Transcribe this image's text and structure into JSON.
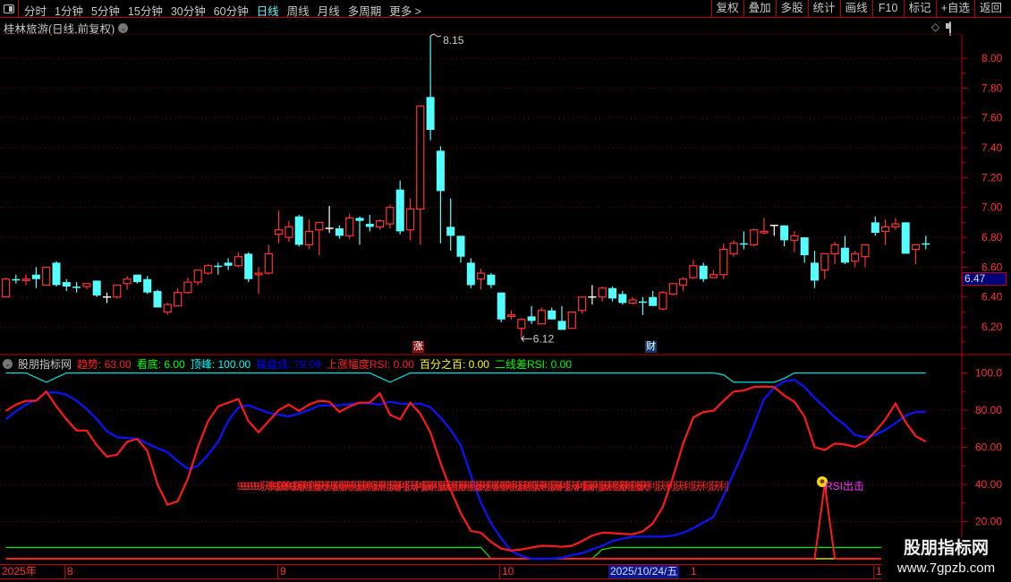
{
  "toolbar": {
    "periods": [
      "分时",
      "1分钟",
      "5分钟",
      "15分钟",
      "30分钟",
      "60分钟",
      "日线",
      "周线",
      "月线",
      "多周期",
      "更多 >"
    ],
    "active_period": "日线",
    "right_buttons": [
      "复权",
      "叠加",
      "多股",
      "统计",
      "画线",
      "F10",
      "标记",
      "+自选",
      "返回"
    ]
  },
  "chart_header": {
    "title": "桂林旅游(日线,前复权)"
  },
  "price_axis": {
    "ticks": [
      "8.00",
      "7.80",
      "7.60",
      "7.40",
      "7.20",
      "7.00",
      "6.80",
      "6.60",
      "6.40",
      "6.20"
    ],
    "current_price": "6.47"
  },
  "annotations": {
    "high_label": "8.15",
    "low_label": "6.12",
    "badge_zhang": "涨",
    "badge_cai": "财"
  },
  "indicator": {
    "name": "股朋指标网",
    "fields": [
      {
        "label": "趋势",
        "value": "63.00",
        "color": "#ff2020"
      },
      {
        "label": "看底",
        "value": "6.00",
        "color": "#00ff00"
      },
      {
        "label": "顶峰",
        "value": "100.00",
        "color": "#00ffff"
      },
      {
        "label": "操盘线",
        "value": "79.09",
        "color": "#0000ff"
      },
      {
        "label": "上涨幅度RSI",
        "value": "0.00",
        "color": "#ff2020"
      },
      {
        "label": "百分之百",
        "value": "0.00",
        "color": "#ffff00"
      },
      {
        "label": "二线差RSI",
        "value": "0.00",
        "color": "#00ff00"
      }
    ],
    "axis_ticks": [
      "100.0",
      "80.00",
      "60.00",
      "40.00",
      "20.00"
    ],
    "overlap_text": "9999999获利获利获利获利获利获利获利获利获利获利获利获利获利获利获利获利获利获利获利获利获利获利获利获利",
    "signal_label": "RSI出击"
  },
  "time_axis": {
    "labels": [
      "2025年",
      "8",
      "9",
      "10",
      "1",
      "1"
    ],
    "highlight": "2025/10/24/五"
  },
  "watermark": {
    "title": "股朋指标网",
    "url": "www.7gpzb.com"
  },
  "chart_data": {
    "type": "candlestick",
    "price_range": [
      6.1,
      8.25
    ],
    "ohlc": [
      [
        6.4,
        6.53,
        6.4,
        6.52
      ],
      [
        6.52,
        6.55,
        6.49,
        6.515
      ],
      [
        6.51,
        6.55,
        6.48,
        6.52
      ],
      [
        6.55,
        6.6,
        6.46,
        6.52
      ],
      [
        6.48,
        6.6,
        6.48,
        6.6
      ],
      [
        6.63,
        6.64,
        6.47,
        6.48
      ],
      [
        6.5,
        6.52,
        6.44,
        6.47
      ],
      [
        6.47,
        6.5,
        6.43,
        6.465
      ],
      [
        6.47,
        6.49,
        6.45,
        6.49
      ],
      [
        6.51,
        6.51,
        6.4,
        6.41
      ],
      [
        6.4,
        6.43,
        6.36,
        6.4
      ],
      [
        6.4,
        6.48,
        6.39,
        6.48
      ],
      [
        6.49,
        6.54,
        6.45,
        6.52
      ],
      [
        6.55,
        6.55,
        6.49,
        6.5
      ],
      [
        6.52,
        6.54,
        6.42,
        6.43
      ],
      [
        6.44,
        6.45,
        6.33,
        6.33
      ],
      [
        6.3,
        6.36,
        6.28,
        6.35
      ],
      [
        6.34,
        6.46,
        6.34,
        6.43
      ],
      [
        6.43,
        6.53,
        6.42,
        6.5
      ],
      [
        6.5,
        6.58,
        6.48,
        6.58
      ],
      [
        6.56,
        6.62,
        6.55,
        6.61
      ],
      [
        6.61,
        6.63,
        6.55,
        6.605
      ],
      [
        6.63,
        6.66,
        6.58,
        6.61
      ],
      [
        6.61,
        6.7,
        6.6,
        6.67
      ],
      [
        6.69,
        6.7,
        6.5,
        6.52
      ],
      [
        6.55,
        6.6,
        6.42,
        6.56
      ],
      [
        6.56,
        6.75,
        6.55,
        6.69
      ],
      [
        6.82,
        6.98,
        6.76,
        6.85
      ],
      [
        6.8,
        6.91,
        6.77,
        6.87
      ],
      [
        6.94,
        6.95,
        6.74,
        6.75
      ],
      [
        6.75,
        6.92,
        6.72,
        6.84
      ],
      [
        6.85,
        6.9,
        6.68,
        6.9
      ],
      [
        6.86,
        7.01,
        6.83,
        6.86
      ],
      [
        6.86,
        6.88,
        6.79,
        6.81
      ],
      [
        6.81,
        6.96,
        6.79,
        6.93
      ],
      [
        6.93,
        6.94,
        6.75,
        6.91
      ],
      [
        6.89,
        6.95,
        6.84,
        6.87
      ],
      [
        6.87,
        6.92,
        6.85,
        6.91
      ],
      [
        6.89,
        7.02,
        6.86,
        7.0
      ],
      [
        7.12,
        7.18,
        6.82,
        6.84
      ],
      [
        6.85,
        7.06,
        6.78,
        6.99
      ],
      [
        6.99,
        7.68,
        6.75,
        7.68
      ],
      [
        7.74,
        8.15,
        7.45,
        7.52
      ],
      [
        7.38,
        7.41,
        6.76,
        7.11
      ],
      [
        6.87,
        7.06,
        6.71,
        6.81
      ],
      [
        6.81,
        6.81,
        6.63,
        6.67
      ],
      [
        6.63,
        6.66,
        6.46,
        6.48
      ],
      [
        6.52,
        6.59,
        6.45,
        6.56
      ],
      [
        6.55,
        6.56,
        6.46,
        6.48
      ],
      [
        6.43,
        6.43,
        6.23,
        6.25
      ],
      [
        6.27,
        6.31,
        6.25,
        6.28
      ],
      [
        6.19,
        6.26,
        6.12,
        6.25
      ],
      [
        6.27,
        6.34,
        6.22,
        6.24
      ],
      [
        6.22,
        6.33,
        6.22,
        6.31
      ],
      [
        6.31,
        6.33,
        6.25,
        6.25
      ],
      [
        6.24,
        6.34,
        6.18,
        6.18
      ],
      [
        6.19,
        6.3,
        6.19,
        6.3
      ],
      [
        6.31,
        6.4,
        6.29,
        6.4
      ],
      [
        6.4,
        6.48,
        6.35,
        6.4
      ],
      [
        6.4,
        6.47,
        6.37,
        6.46
      ],
      [
        6.46,
        6.47,
        6.37,
        6.39
      ],
      [
        6.42,
        6.44,
        6.35,
        6.36
      ],
      [
        6.36,
        6.4,
        6.35,
        6.38
      ],
      [
        6.37,
        6.4,
        6.28,
        6.365
      ],
      [
        6.4,
        6.44,
        6.34,
        6.34
      ],
      [
        6.32,
        6.44,
        6.31,
        6.43
      ],
      [
        6.42,
        6.49,
        6.41,
        6.49
      ],
      [
        6.48,
        6.53,
        6.44,
        6.52
      ],
      [
        6.53,
        6.65,
        6.52,
        6.61
      ],
      [
        6.61,
        6.63,
        6.5,
        6.52
      ],
      [
        6.53,
        6.58,
        6.53,
        6.55
      ],
      [
        6.55,
        6.76,
        6.52,
        6.72
      ],
      [
        6.69,
        6.78,
        6.67,
        6.76
      ],
      [
        6.76,
        6.84,
        6.72,
        6.755
      ],
      [
        6.75,
        6.86,
        6.74,
        6.85
      ],
      [
        6.83,
        6.93,
        6.82,
        6.84
      ],
      [
        6.88,
        6.88,
        6.81,
        6.88
      ],
      [
        6.88,
        6.88,
        6.74,
        6.78
      ],
      [
        6.78,
        6.84,
        6.7,
        6.81
      ],
      [
        6.8,
        6.8,
        6.63,
        6.68
      ],
      [
        6.63,
        6.71,
        6.46,
        6.51
      ],
      [
        6.58,
        6.69,
        6.52,
        6.69
      ],
      [
        6.69,
        6.77,
        6.62,
        6.75
      ],
      [
        6.73,
        6.81,
        6.62,
        6.63
      ],
      [
        6.64,
        6.71,
        6.6,
        6.69
      ],
      [
        6.67,
        6.75,
        6.6,
        6.75
      ],
      [
        6.9,
        6.94,
        6.81,
        6.83
      ],
      [
        6.84,
        6.92,
        6.75,
        6.87
      ],
      [
        6.87,
        6.93,
        6.85,
        6.89
      ],
      [
        6.9,
        6.9,
        6.69,
        6.69
      ],
      [
        6.72,
        6.75,
        6.62,
        6.75
      ],
      [
        6.76,
        6.81,
        6.72,
        6.755
      ]
    ],
    "indicator_range": [
      0,
      100
    ],
    "series": [
      {
        "name": "趋势",
        "color": "#ff1a1a",
        "values": [
          79.5,
          83,
          85,
          85,
          90,
          82,
          75,
          69,
          69,
          61,
          55,
          56,
          63,
          64.5,
          58,
          40,
          29,
          31,
          43,
          60,
          74,
          82,
          84,
          86,
          74,
          68,
          74,
          80,
          83,
          79.5,
          83,
          85,
          84.5,
          79,
          82,
          84,
          84,
          89,
          77.5,
          75,
          84,
          78,
          68,
          51.5,
          37,
          24.5,
          15,
          14,
          9,
          5.5,
          4.4,
          5,
          6,
          7,
          6.8,
          6.4,
          7,
          9.5,
          12.5,
          14,
          13.8,
          13.4,
          13.2,
          14.7,
          19,
          28,
          44,
          62,
          76,
          79,
          79.6,
          85,
          90,
          90.5,
          92.5,
          92.7,
          92.4,
          87.8,
          84.5,
          76.5,
          60,
          58.5,
          62,
          61.5,
          60.2,
          63,
          68.5,
          75,
          83.5,
          73.5,
          66,
          63
        ]
      },
      {
        "name": "操盘线",
        "color": "#0a14ff",
        "values": [
          75,
          79.4,
          83,
          85.5,
          89.5,
          89.5,
          88.3,
          85,
          80.6,
          75,
          68.6,
          65.4,
          65,
          64.6,
          62,
          59.5,
          57.3,
          52.5,
          48.5,
          50,
          56,
          63,
          74.2,
          81.4,
          82.6,
          80.5,
          78.5,
          77.5,
          76.6,
          78.2,
          80,
          82.5,
          82.6,
          82.6,
          83.2,
          83.9,
          83.5,
          83,
          84.5,
          83.5,
          83.2,
          83.5,
          81.5,
          76,
          69.4,
          61,
          45,
          30,
          19,
          11,
          4,
          1.5,
          0,
          0,
          0,
          0.5,
          2,
          3,
          5,
          7,
          9.5,
          10.8,
          11.8,
          11.9,
          11.9,
          11.9,
          12.5,
          14,
          16.5,
          19.5,
          22.5,
          34,
          46,
          58.2,
          72,
          86,
          92,
          95.5,
          96.2,
          92.5,
          86.5,
          81.5,
          76,
          72,
          66.5,
          65.4,
          66.5,
          69.4,
          73,
          77,
          79,
          79.1
        ]
      },
      {
        "name": "顶峰",
        "color": "#00e0e0",
        "values": [
          100,
          100,
          100,
          97.5,
          95,
          97.5,
          100,
          100,
          100,
          100,
          100,
          100,
          100,
          100,
          100,
          100,
          100,
          100,
          100,
          100,
          100,
          100,
          100,
          100,
          100,
          100,
          100,
          100,
          100,
          100,
          100,
          100,
          100,
          100,
          100,
          100,
          100,
          97.5,
          95,
          97.5,
          100,
          100,
          100,
          100,
          100,
          100,
          100,
          100,
          100,
          100,
          100,
          100,
          100,
          100,
          100,
          100,
          100,
          100,
          100,
          100,
          100,
          100,
          100,
          100,
          100,
          100,
          100,
          100,
          100,
          100,
          100,
          99,
          95,
          95,
          95,
          95,
          95,
          97,
          100,
          100,
          100,
          100,
          100,
          100,
          100,
          100,
          100,
          100,
          100,
          100,
          100,
          100
        ]
      },
      {
        "name": "看底",
        "color": "#00ee00",
        "values": [
          6,
          6,
          6,
          6,
          6,
          6,
          6,
          6,
          6,
          6,
          6,
          6,
          6,
          6,
          6,
          6,
          6,
          6,
          6,
          6,
          6,
          6,
          6,
          6,
          6,
          6,
          6,
          6,
          6,
          6,
          6,
          6,
          6,
          6,
          6,
          6,
          6,
          6,
          6,
          6,
          6,
          6,
          6,
          6,
          6,
          6,
          6,
          6,
          0,
          0,
          0,
          0,
          0,
          0,
          0,
          0,
          0,
          0,
          0,
          5,
          6,
          6,
          6,
          6,
          6,
          6,
          6,
          6,
          6,
          6,
          6,
          6,
          6,
          6,
          6,
          6,
          6,
          6,
          6,
          6,
          6,
          6,
          6,
          6,
          6,
          6,
          6,
          6,
          6,
          6,
          6,
          6
        ]
      },
      {
        "name": "上涨幅度RSI",
        "color": "#ff1a1a",
        "values": [
          0,
          0,
          0,
          0,
          0,
          0,
          0,
          0,
          0,
          0,
          0,
          0,
          0,
          0,
          0,
          0,
          0,
          0,
          0,
          0,
          0,
          0,
          0,
          0,
          0,
          0,
          0,
          0,
          0,
          0,
          0,
          0,
          0,
          0,
          0,
          0,
          0,
          0,
          0,
          0,
          0,
          0,
          0,
          0,
          0,
          0,
          0,
          0,
          0,
          0,
          0,
          0,
          0,
          0,
          0,
          0,
          0,
          0,
          0,
          0,
          0,
          0,
          0,
          0,
          0,
          0,
          0,
          0,
          0,
          0,
          0,
          0,
          0,
          0,
          0,
          0,
          0,
          0,
          0,
          0,
          0,
          40,
          0,
          0,
          0,
          0,
          0,
          0,
          0,
          0,
          0,
          0
        ]
      },
      {
        "name": "百分之百",
        "color": "#ffff00",
        "values": [
          0,
          0,
          0,
          0,
          0,
          0,
          0,
          0,
          0,
          0,
          0,
          0,
          0,
          0,
          0,
          0,
          0,
          0,
          0,
          0,
          0,
          0,
          0,
          0,
          0,
          0,
          0,
          0,
          0,
          0,
          0,
          0,
          0,
          0,
          0,
          0,
          0,
          0,
          0,
          0,
          0,
          0,
          0,
          0,
          0,
          0,
          0,
          0,
          0,
          0,
          0,
          0,
          0,
          0,
          0,
          0,
          0,
          0,
          0,
          0,
          0,
          0,
          0,
          0,
          0,
          0,
          0,
          0,
          0,
          0,
          0,
          0,
          0,
          0,
          0,
          0,
          0,
          0,
          0,
          0,
          0,
          0,
          0,
          0,
          0,
          0,
          0,
          0,
          0,
          0,
          0,
          0
        ]
      }
    ]
  }
}
